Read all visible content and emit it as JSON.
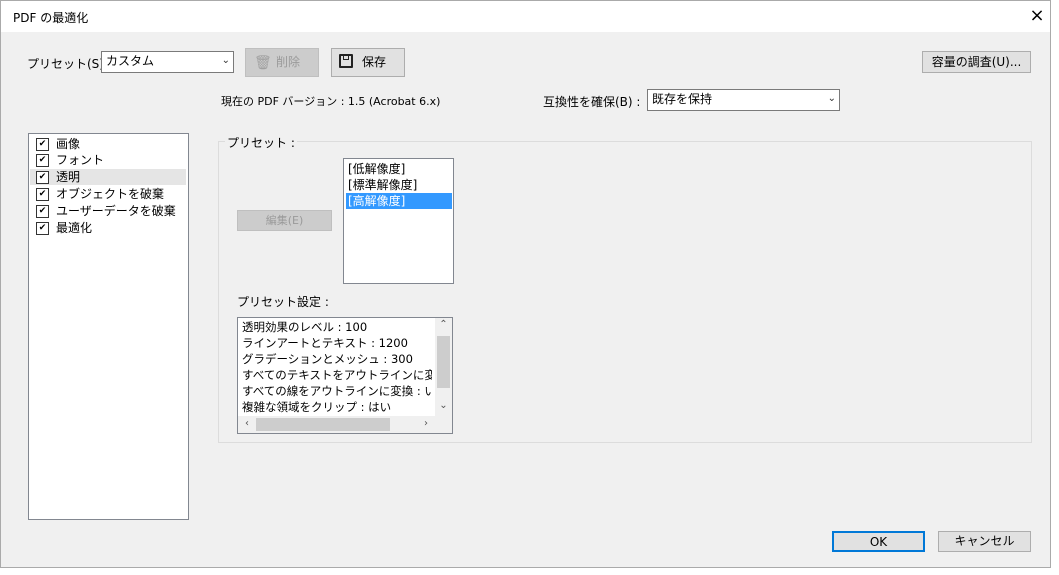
{
  "window": {
    "title": "PDF の最適化",
    "close_glyph": "×"
  },
  "toolbar": {
    "preset_label": "プリセット(S) :",
    "preset_value": "カスタム",
    "delete_label": "削除",
    "save_label": "保存",
    "audit_label": "容量の調査(U)..."
  },
  "info": {
    "pdf_version_text": "現在の PDF バージョン : 1.5 (Acrobat 6.x)",
    "compat_label": "互換性を確保(B) :",
    "compat_value": "既存を保持"
  },
  "categories": [
    {
      "label": "画像",
      "checked": true
    },
    {
      "label": "フォント",
      "checked": true
    },
    {
      "label": "透明",
      "checked": true,
      "selected": true
    },
    {
      "label": "オブジェクトを破棄",
      "checked": true
    },
    {
      "label": "ユーザーデータを破棄",
      "checked": true
    },
    {
      "label": "最適化",
      "checked": true
    }
  ],
  "presets_group": {
    "title": "プリセット :",
    "edit_label": "編集(E)",
    "items": [
      "[低解像度]",
      "[標準解像度]",
      "[高解像度]"
    ],
    "selected_index": 2
  },
  "preset_settings": {
    "title": "プリセット設定 :",
    "lines": [
      "透明効果のレベル : 100",
      "ラインアートとテキスト : 1200",
      "グラデーションとメッシュ : 300",
      "すべてのテキストをアウトラインに変換 :",
      "すべての線をアウトラインに変換 : いいえ",
      "複雑な領域をクリップ : はい"
    ]
  },
  "footer": {
    "ok_label": "OK",
    "cancel_label": "キャンセル"
  },
  "colors": {
    "selection": "#3399ff",
    "dialog_bg": "#f0f0f0"
  }
}
